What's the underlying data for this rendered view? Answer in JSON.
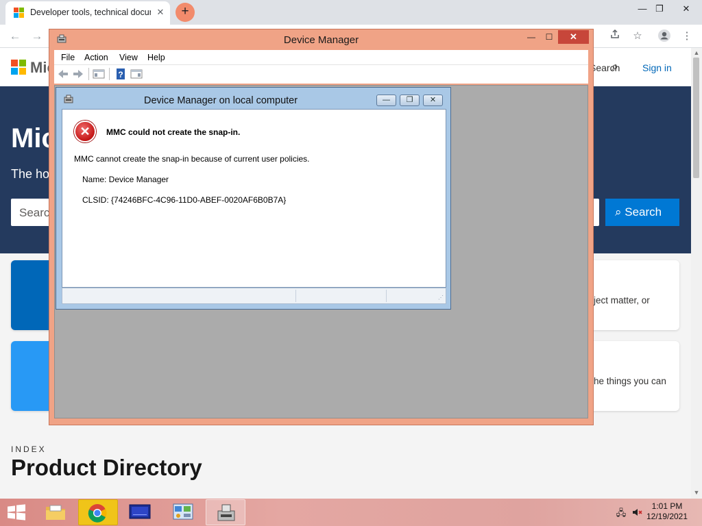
{
  "browser": {
    "tab_title": "Developer tools, technical documentation",
    "tab_close": "✕",
    "new_tab": "+",
    "window_controls": {
      "minimize": "—",
      "restore": "❐",
      "close": "✕"
    },
    "nav": {
      "back": "←",
      "forward": "→"
    }
  },
  "site": {
    "brand": "Microsoft",
    "search_link": "Search",
    "signin": "Sign in",
    "hero_title": "Microsoft Learn",
    "hero_subtitle": "The home for Microsoft documentation",
    "search_placeholder": "Search",
    "search_button": "Search",
    "card1_text": "ject matter, or",
    "card2_text": "he things you can",
    "index_label": "INDEX",
    "product_directory": "Product Directory",
    "colors": {
      "hero": "#243a5e",
      "accent": "#0078d4",
      "card_tile1": "#0067b8",
      "card_tile2": "#2899f5"
    }
  },
  "mmc": {
    "title": "Device Manager",
    "menu": [
      "File",
      "Action",
      "View",
      "Help"
    ],
    "controls": {
      "minimize": "—",
      "maximize": "☐",
      "close": "✕"
    }
  },
  "dialog": {
    "title": "Device Manager on local computer",
    "heading": "MMC could not create the snap-in.",
    "message": "MMC cannot create the snap-in because of current user policies.",
    "name_line": "Name: Device Manager",
    "clsid_line": "CLSID: {74246BFC-4C96-11D0-ABEF-0020AF6B0B7A}",
    "error_glyph": "✕",
    "controls": {
      "minimize": "—",
      "restore": "❐",
      "close": "✕"
    }
  },
  "taskbar": {
    "items": [
      "file-explorer",
      "chrome",
      "remote-desktop",
      "control-panel",
      "device-manager"
    ],
    "time": "1:01 PM",
    "date": "12/19/2021"
  }
}
